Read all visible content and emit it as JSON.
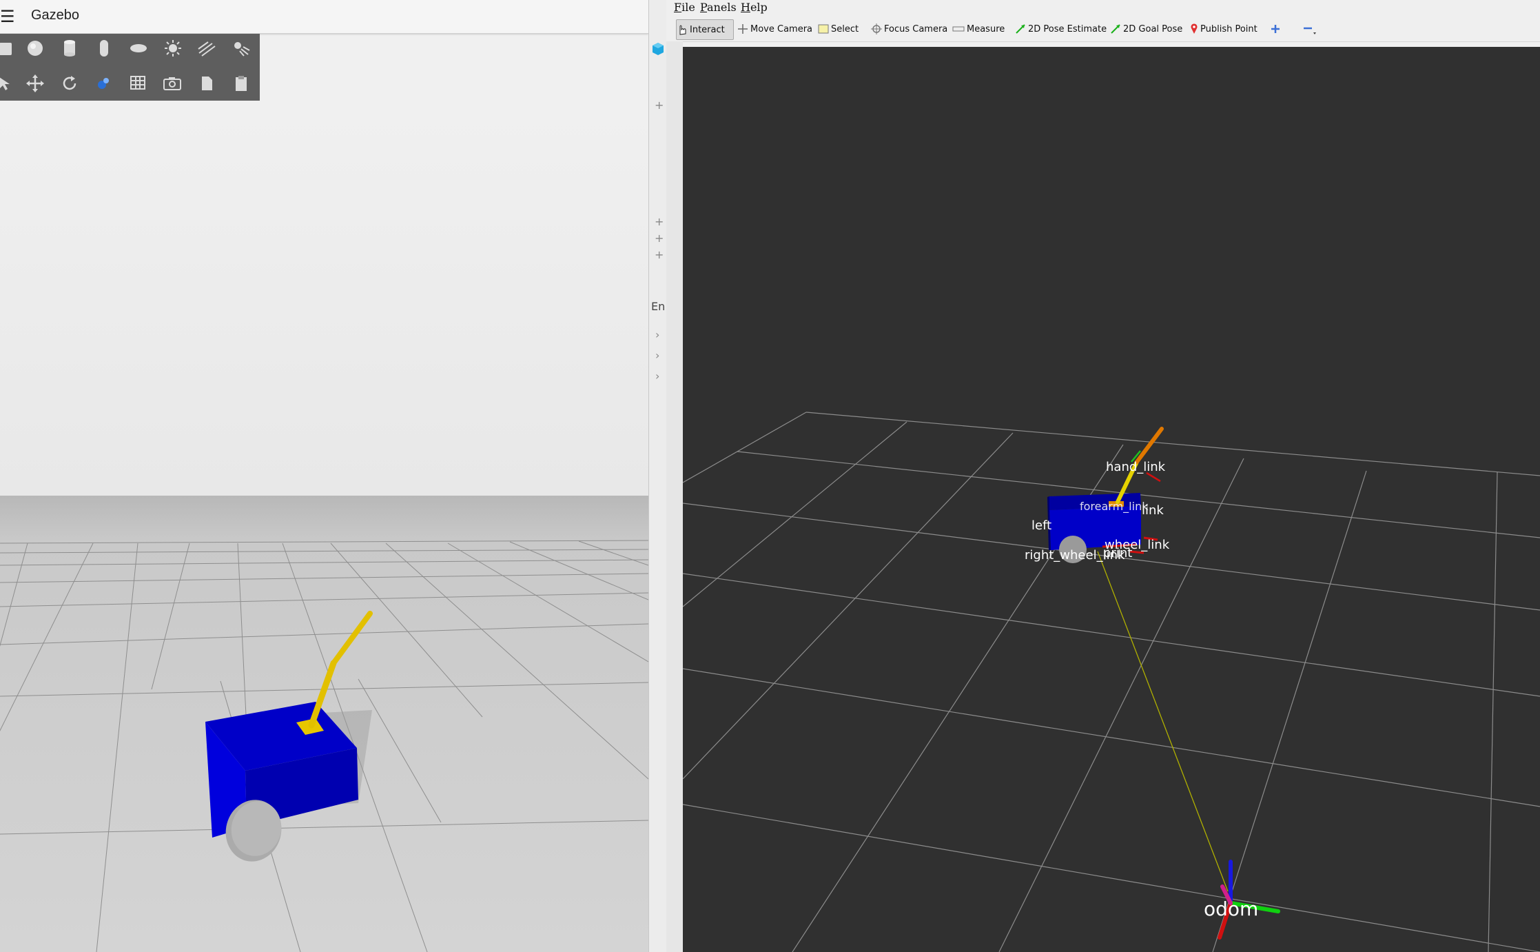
{
  "gazebo": {
    "title": "Gazebo",
    "menu_icon": "hamburger-menu-icon",
    "toolbar_row1": [
      "box-shape-icon",
      "sphere-shape-icon",
      "cylinder-shape-icon",
      "capsule-shape-icon",
      "ellipsoid-shape-icon",
      "point-light-icon",
      "directional-light-icon",
      "spot-light-icon"
    ],
    "toolbar_row2": [
      "select-arrow-icon",
      "translate-icon",
      "rotate-icon",
      "scale-icon",
      "grid-snap-icon",
      "screenshot-icon",
      "copy-icon",
      "paste-icon"
    ],
    "side_panel_label": "En",
    "colors": {
      "robot_body": "#0000cc",
      "arm": "#e8c600",
      "wheel": "#a9a9a9",
      "ground": "#cfcfcf",
      "sky": "#ececec"
    }
  },
  "rviz": {
    "menu": [
      {
        "key": "file",
        "accel": "F",
        "rest": "ile"
      },
      {
        "key": "panels",
        "accel": "P",
        "rest": "anels"
      },
      {
        "key": "help",
        "accel": "H",
        "rest": "elp"
      }
    ],
    "tools": [
      {
        "key": "interact",
        "label": "Interact",
        "icon": "hand-pointer-icon",
        "active": true
      },
      {
        "key": "move-camera",
        "label": "Move Camera",
        "icon": "move-camera-icon"
      },
      {
        "key": "select",
        "label": "Select",
        "icon": "select-box-icon"
      },
      {
        "key": "focus-camera",
        "label": "Focus Camera",
        "icon": "focus-target-icon"
      },
      {
        "key": "measure",
        "label": "Measure",
        "icon": "ruler-icon"
      },
      {
        "key": "pose-estimate",
        "label": "2D Pose Estimate",
        "icon": "green-arrow-icon"
      },
      {
        "key": "goal-pose",
        "label": "2D Goal Pose",
        "icon": "green-arrow-icon"
      },
      {
        "key": "publish-point",
        "label": "Publish Point",
        "icon": "map-pin-icon"
      }
    ],
    "frame_labels": {
      "hand": "hand_link",
      "forearm": "forearm_link",
      "link": "link",
      "left": "left",
      "left_wheel": "wheel_link",
      "right_wheel": "right_wheel_link",
      "footprint": "print",
      "odom": "odom"
    },
    "colors": {
      "background": "#303030",
      "grid": "#8a8a8a",
      "body": "#00007a",
      "tf_line": "#b5b500"
    }
  }
}
